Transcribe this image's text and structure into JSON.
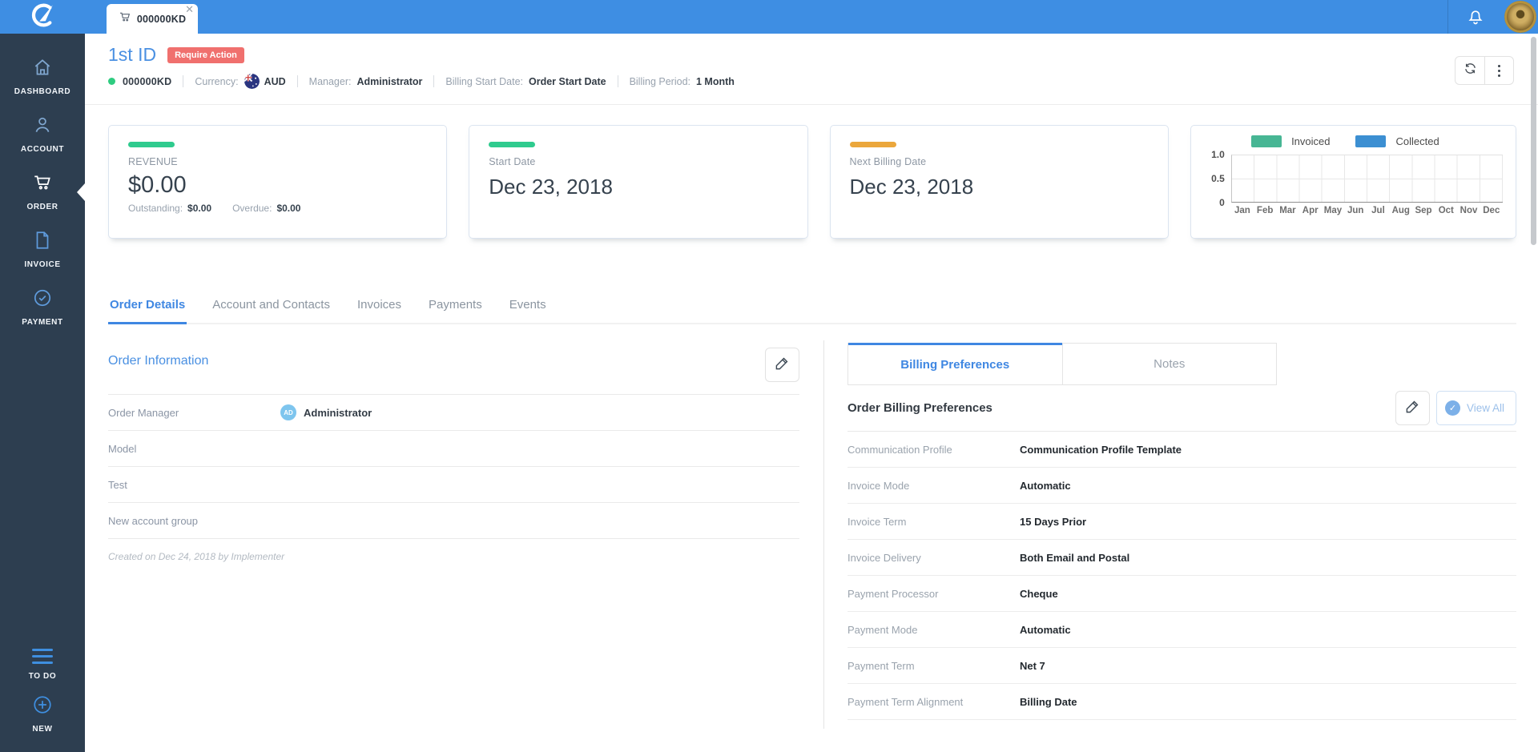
{
  "topbar": {
    "tab_label": "000000KD"
  },
  "sidebar": {
    "items": [
      {
        "label": "DASHBOARD"
      },
      {
        "label": "ACCOUNT"
      },
      {
        "label": "ORDER",
        "active": true
      },
      {
        "label": "INVOICE"
      },
      {
        "label": "PAYMENT"
      }
    ],
    "bottom_items": [
      {
        "label": "TO DO"
      },
      {
        "label": "NEW"
      }
    ]
  },
  "header": {
    "title": "1st ID",
    "badge": "Require Action",
    "badge_color": "#f0706e",
    "order_number": "000000KD",
    "status_color": "#2ecc80",
    "meta": [
      {
        "label": "Currency:",
        "value": "AUD"
      },
      {
        "label": "Manager:",
        "value": "Administrator"
      },
      {
        "label": "Billing Start Date:",
        "value": "Order Start Date"
      },
      {
        "label": "Billing Period:",
        "value": "1 Month"
      }
    ]
  },
  "cards": {
    "revenue": {
      "accent_color": "#2fcb8e",
      "label": "REVENUE",
      "amount": "$0.00",
      "outstanding_label": "Outstanding:",
      "outstanding_value": "$0.00",
      "overdue_label": "Overdue:",
      "overdue_value": "$0.00"
    },
    "start_date": {
      "accent_color": "#2fcb8e",
      "label": "Start Date",
      "value": "Dec 23, 2018"
    },
    "next_billing": {
      "accent_color": "#eba73c",
      "label": "Next Billing Date",
      "value": "Dec 23, 2018"
    }
  },
  "chart_data": {
    "type": "bar",
    "title": "",
    "categories": [
      "Jan",
      "Feb",
      "Mar",
      "Apr",
      "May",
      "Jun",
      "Jul",
      "Aug",
      "Sep",
      "Oct",
      "Nov",
      "Dec"
    ],
    "series": [
      {
        "name": "Invoiced",
        "color": "#47b694",
        "values": [
          0,
          0,
          0,
          0,
          0,
          0,
          0,
          0,
          0,
          0,
          0,
          0
        ]
      },
      {
        "name": "Collected",
        "color": "#3c8fd2",
        "values": [
          0,
          0,
          0,
          0,
          0,
          0,
          0,
          0,
          0,
          0,
          0,
          0
        ]
      }
    ],
    "ylim": [
      0,
      1
    ],
    "yticks": [
      0,
      0.5,
      1.0
    ],
    "ytick_labels": [
      "1.0",
      "0.5",
      "0"
    ],
    "grid": true,
    "legend_position": "top"
  },
  "tabs": [
    {
      "label": "Order Details",
      "active": true
    },
    {
      "label": "Account and Contacts"
    },
    {
      "label": "Invoices"
    },
    {
      "label": "Payments"
    },
    {
      "label": "Events"
    }
  ],
  "order_info": {
    "heading": "Order Information",
    "rows": [
      {
        "label": "Order Manager",
        "value": "Administrator",
        "avatar": "AD"
      },
      {
        "label": "Model",
        "value": ""
      },
      {
        "label": "Test",
        "value": ""
      },
      {
        "label": "New account group",
        "value": ""
      }
    ],
    "footer": "Created on Dec 24, 2018 by Implementer"
  },
  "billing": {
    "tabs": [
      {
        "label": "Billing Preferences",
        "active": true
      },
      {
        "label": "Notes"
      }
    ],
    "heading": "Order Billing Preferences",
    "view_all_label": "View All",
    "fields": [
      {
        "label": "Communication Profile",
        "value": "Communication Profile Template"
      },
      {
        "label": "Invoice Mode",
        "value": "Automatic"
      },
      {
        "label": "Invoice Term",
        "value": "15 Days Prior"
      },
      {
        "label": "Invoice Delivery",
        "value": "Both Email and Postal"
      },
      {
        "label": "Payment Processor",
        "value": "Cheque"
      },
      {
        "label": "Payment Mode",
        "value": "Automatic"
      },
      {
        "label": "Payment Term",
        "value": "Net 7"
      },
      {
        "label": "Payment Term Alignment",
        "value": "Billing Date"
      }
    ]
  }
}
